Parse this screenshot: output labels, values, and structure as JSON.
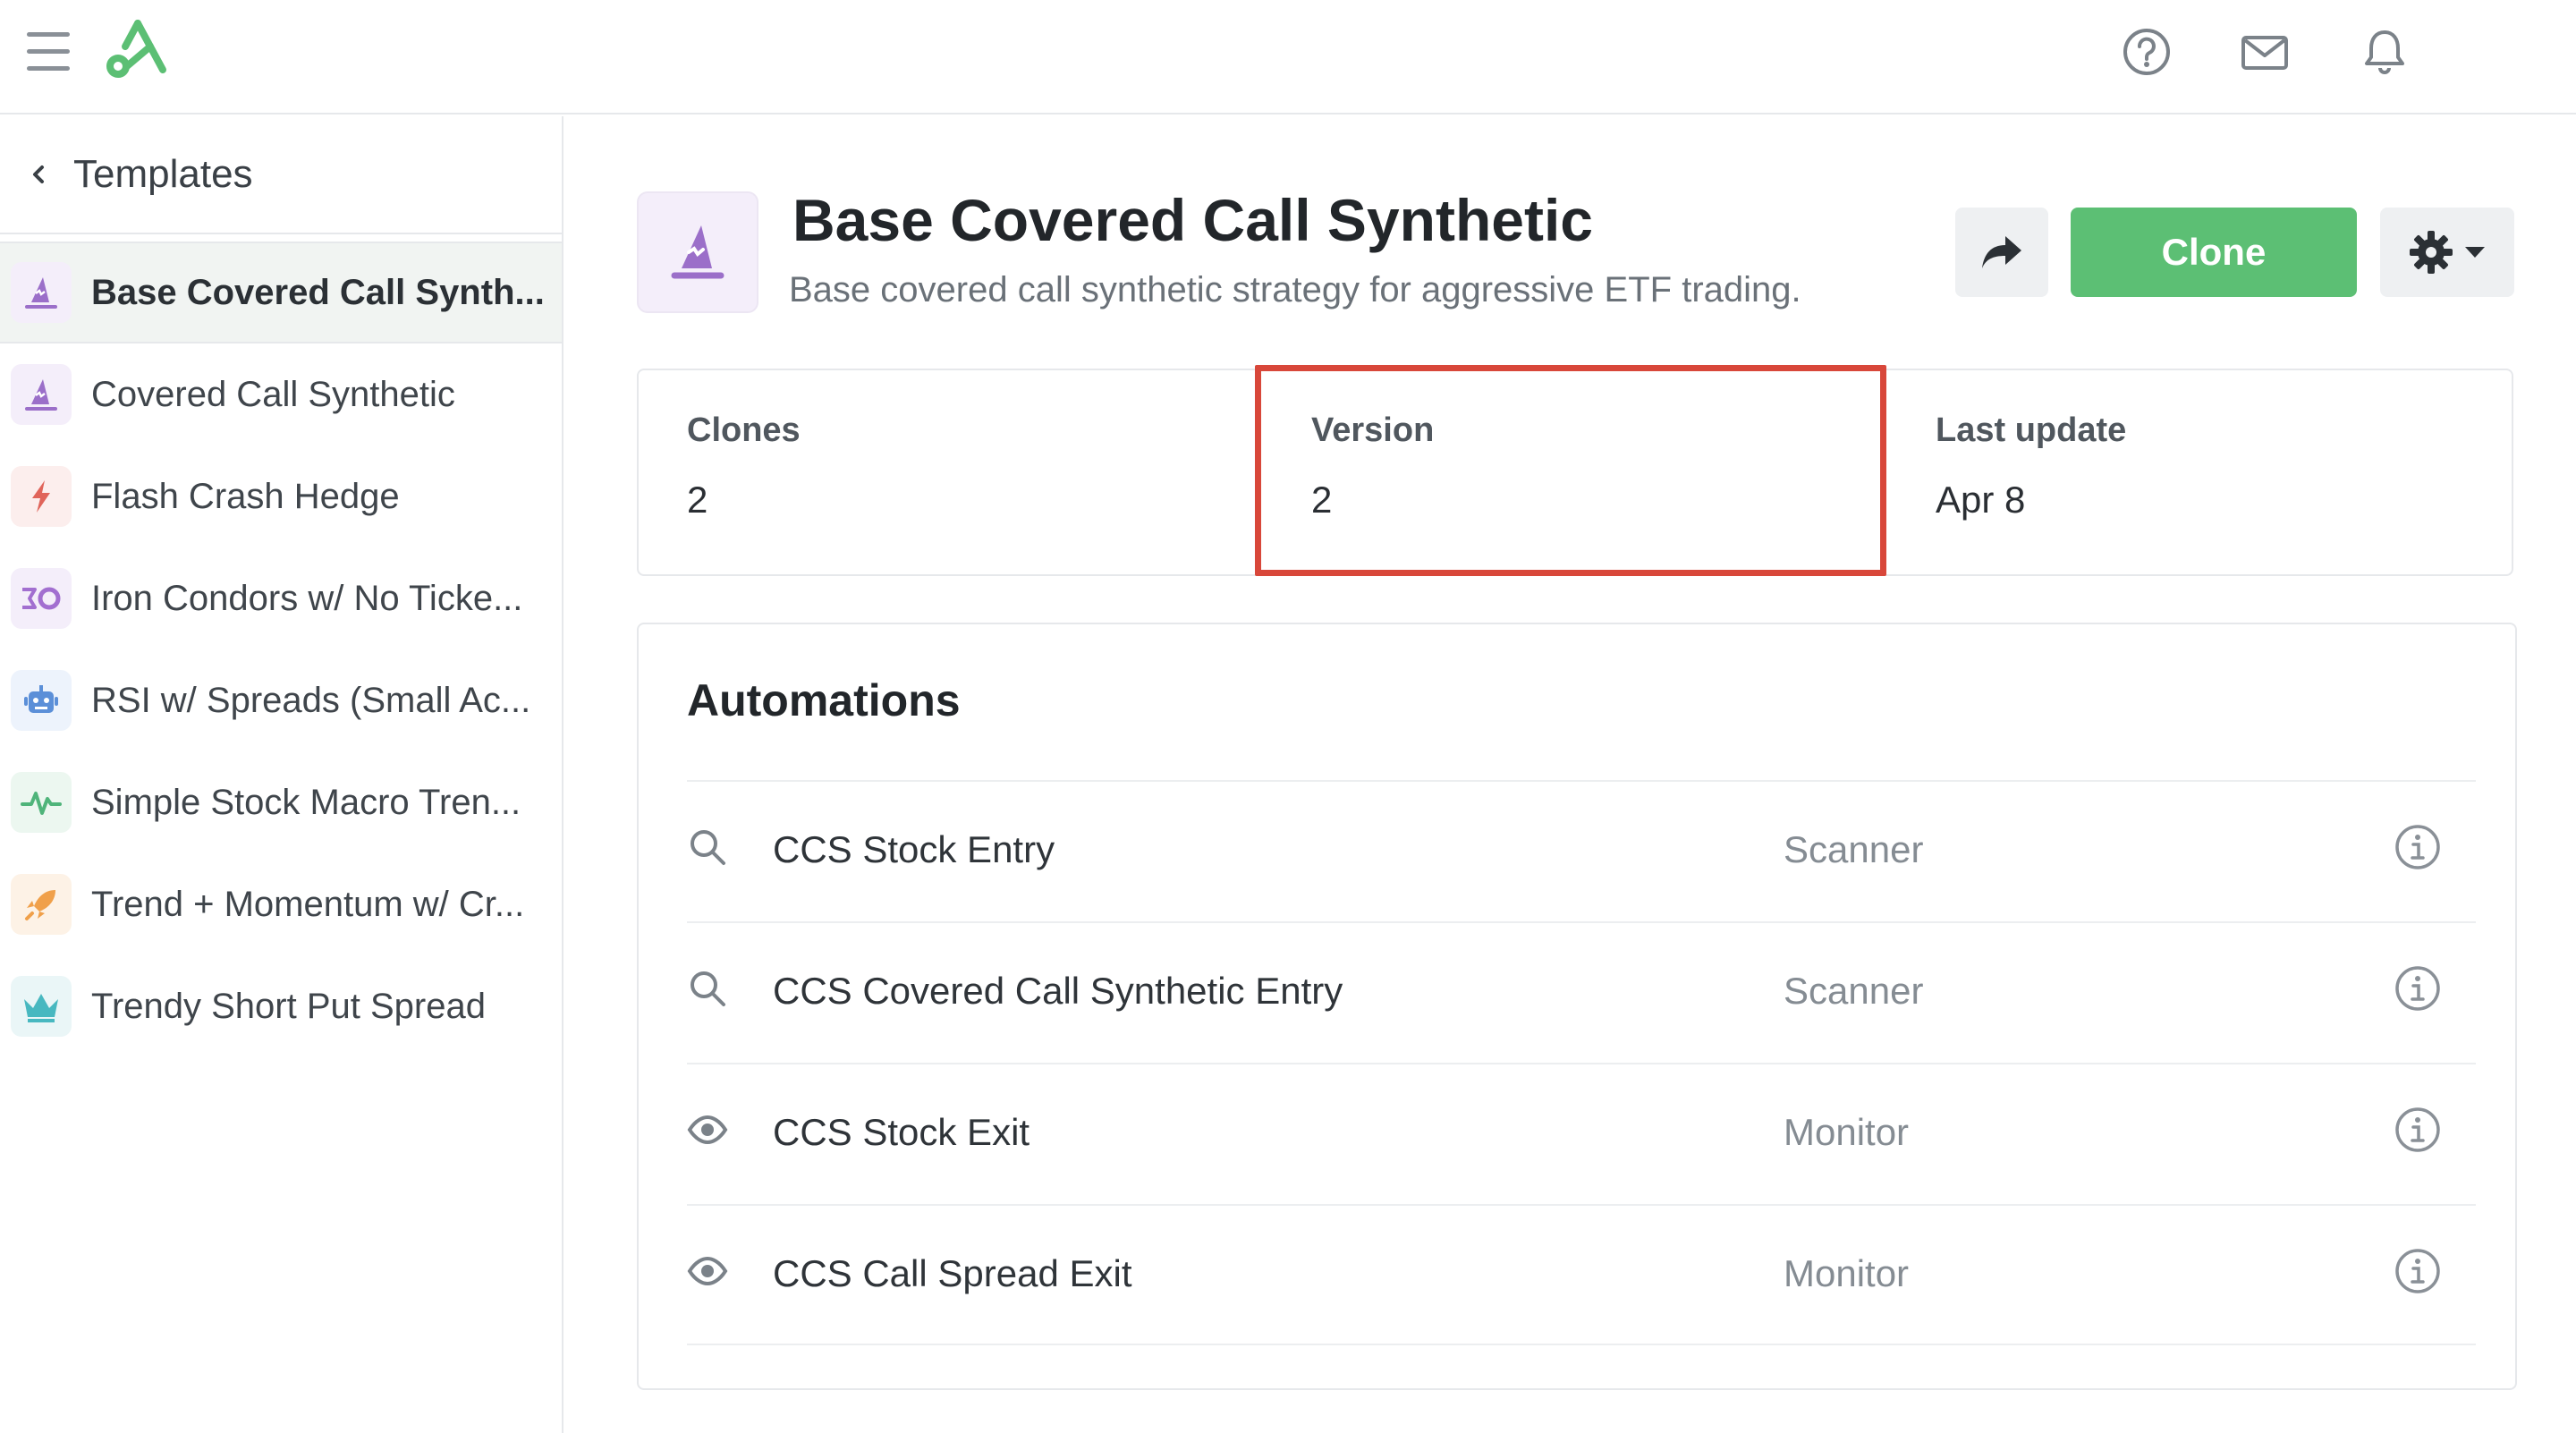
{
  "sidebar": {
    "title": "Templates",
    "items": [
      {
        "label": "Base Covered Call Synth...",
        "icon": "wizard-hat-icon",
        "color": "#9b6fc9",
        "bg": "#f4eefa",
        "active": true
      },
      {
        "label": "Covered Call Synthetic",
        "icon": "wizard-hat-icon",
        "color": "#9b6fc9",
        "bg": "#f4eefa",
        "active": false
      },
      {
        "label": "Flash Crash Hedge",
        "icon": "lightning-icon",
        "color": "#e0645a",
        "bg": "#fceeed",
        "active": false
      },
      {
        "label": "Iron Condors w/ No Ticke...",
        "icon": "iron-condor-icon",
        "color": "#a26fd0",
        "bg": "#f4eefa",
        "active": false
      },
      {
        "label": "RSI w/ Spreads (Small Ac...",
        "icon": "robot-icon",
        "color": "#5b8fd8",
        "bg": "#edf3fc",
        "active": false
      },
      {
        "label": "Simple Stock Macro Tren...",
        "icon": "pulse-icon",
        "color": "#4fb47a",
        "bg": "#ecf7f0",
        "active": false
      },
      {
        "label": "Trend + Momentum w/ Cr...",
        "icon": "rocket-icon",
        "color": "#f0a04a",
        "bg": "#fdf2e6",
        "active": false
      },
      {
        "label": "Trendy Short Put Spread",
        "icon": "crown-icon",
        "color": "#48b8c0",
        "bg": "#eaf6f7",
        "active": false
      }
    ]
  },
  "strategy": {
    "title": "Base Covered Call Synthetic",
    "description": "Base covered call synthetic strategy for aggressive ETF trading."
  },
  "actions": {
    "clone_label": "Clone"
  },
  "stats": [
    {
      "label": "Clones",
      "value": "2"
    },
    {
      "label": "Version",
      "value": "2"
    },
    {
      "label": "Last update",
      "value": "Apr 8"
    }
  ],
  "automations": {
    "title": "Automations",
    "rows": [
      {
        "name": "CCS Stock Entry",
        "type": "Scanner",
        "icon": "search-icon"
      },
      {
        "name": "CCS Covered Call Synthetic Entry",
        "type": "Scanner",
        "icon": "search-icon"
      },
      {
        "name": "CCS Stock Exit",
        "type": "Monitor",
        "icon": "eye-icon"
      },
      {
        "name": "CCS Call Spread Exit",
        "type": "Monitor",
        "icon": "eye-icon"
      }
    ]
  },
  "colors": {
    "brand": "#5cbf74",
    "highlight": "#d8473a",
    "accent_purple": "#9b6fc9"
  }
}
